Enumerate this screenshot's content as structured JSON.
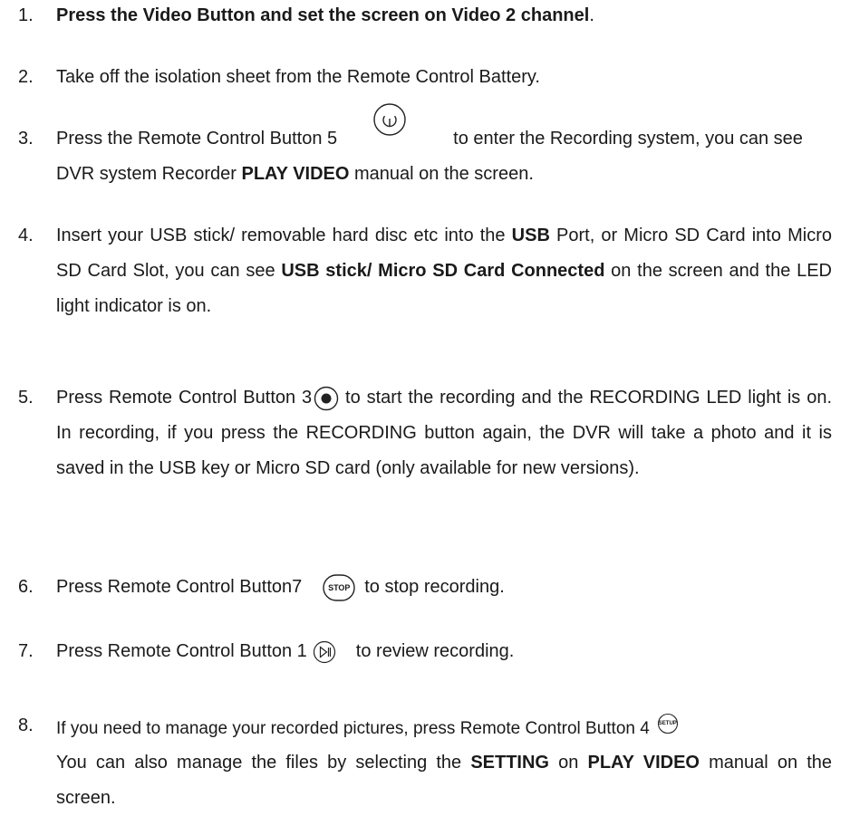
{
  "steps": [
    {
      "num": "1.",
      "parts": [
        "Press the Video Button and set the screen on Video 2 channel",
        "."
      ]
    },
    {
      "num": "2.",
      "parts": [
        "Take off the isolation sheet from the Remote Control Battery."
      ]
    },
    {
      "num": "3.",
      "parts": [
        "Press the Remote Control Button 5",
        "to enter the Recording system, you can see DVR system Recorder ",
        "PLAY VIDEO",
        " manual on the screen."
      ]
    },
    {
      "num": "4.",
      "parts": [
        "Insert your USB stick/ removable hard disc etc into the ",
        "USB",
        " Port, or Micro SD Card into Micro SD Card Slot, you can see ",
        "USB stick/ Micro SD Card Connected",
        " on the screen and the LED light indicator is on."
      ]
    },
    {
      "num": "5.",
      "parts": [
        "Press Remote Control Button 3",
        " to start the recording and the RECORDING LED light is on. In recording, if you press the RECORDING button again, the DVR will take a photo and it is saved in the USB key or Micro SD card (only available for new versions)."
      ]
    },
    {
      "num": "6.",
      "parts": [
        "Press Remote Control Button7",
        "to stop recording."
      ]
    },
    {
      "num": "7.",
      "parts": [
        "Press Remote Control Button 1",
        "to review recording."
      ]
    },
    {
      "num": "8.",
      "parts": [
        "If you need to manage your recorded pictures, press Remote Control Button 4",
        "You can also manage the files by selecting the ",
        "SETTING",
        " on ",
        "PLAY VIDEO",
        " manual on the screen."
      ]
    }
  ],
  "icons": {
    "stop_label": "STOP",
    "setup_label": "SETUP"
  }
}
